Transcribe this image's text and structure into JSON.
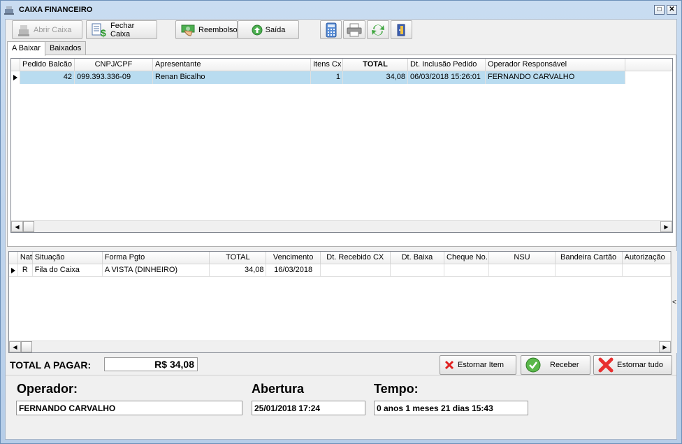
{
  "window": {
    "title": "CAIXA FINANCEIRO"
  },
  "toolbar": {
    "abrir_caixa": "Abrir Caixa",
    "fechar_caixa": "Fechar Caixa",
    "reembolso": "Reembolso",
    "saida": "Saída"
  },
  "tabs": [
    "A Baixar",
    "Baixados"
  ],
  "orders": {
    "columns": [
      "Pedido Balcão",
      "CNPJ/CPF",
      "Apresentante",
      "Itens Cx",
      "TOTAL",
      "Dt. Inclusão Pedido",
      "Operador Responsável"
    ],
    "rows": [
      {
        "pedido": "42",
        "cnpj": "099.393.336-09",
        "apresentante": "Renan Bicalho",
        "itens": "1",
        "total": "34,08",
        "dt_inclusao": "06/03/2018 15:26:01",
        "operador": "FERNANDO CARVALHO"
      }
    ]
  },
  "payments": {
    "columns": [
      "Nat",
      "Situação",
      "Forma Pgto",
      "TOTAL",
      "Vencimento",
      "Dt. Recebido CX",
      "Dt. Baixa",
      "Cheque No.",
      "NSU",
      "Bandeira Cartão",
      "Autorização"
    ],
    "rows": [
      {
        "nat": "R",
        "situacao": "Fila do Caixa",
        "forma": "A VISTA (DINHEIRO)",
        "total": "34,08",
        "vencimento": "16/03/2018",
        "dt_recebido": "",
        "dt_baixa": "",
        "cheque": "",
        "nsu": "",
        "bandeira": "",
        "autorizacao": ""
      }
    ],
    "side_marker": "<"
  },
  "summary": {
    "total_label": "TOTAL A PAGAR:",
    "total_value": "R$ 34,08",
    "estornar_item": "Estornar Item",
    "receber": "Receber",
    "estornar_tudo": "Estornar tudo"
  },
  "info": {
    "operador_label": "Operador:",
    "operador_value": "FERNANDO CARVALHO",
    "abertura_label": "Abertura",
    "abertura_value": "25/01/2018 17:24",
    "tempo_label": "Tempo:",
    "tempo_value": "0 anos 1 meses 21 dias 15:43"
  },
  "colors": {
    "selection": "#b9dcf0",
    "accent_green": "#3a9a2a",
    "danger_red": "#e02020"
  }
}
